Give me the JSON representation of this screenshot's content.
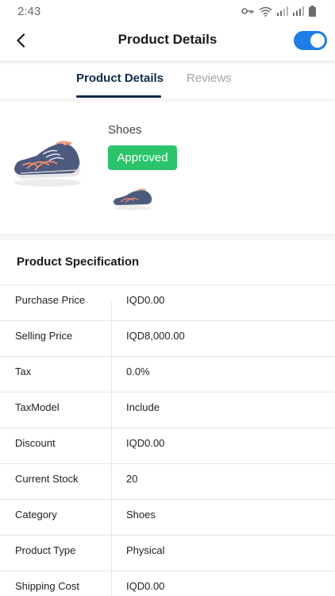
{
  "status_bar": {
    "time": "2:43"
  },
  "header": {
    "title": "Product Details",
    "toggle_on": true,
    "accent_color": "#1e7de6"
  },
  "tabs": [
    {
      "label": "Product Details",
      "active": true
    },
    {
      "label": "Reviews",
      "active": false
    }
  ],
  "product": {
    "name": "Shoes",
    "status": "Approved",
    "status_color": "#2bc46a",
    "image": "shoe-image",
    "thumbnails": [
      "shoe-thumbnail"
    ]
  },
  "specification": {
    "title": "Product Specification",
    "rows": [
      {
        "label": "Purchase Price",
        "value": "IQD0.00"
      },
      {
        "label": "Selling Price",
        "value": "IQD8,000.00"
      },
      {
        "label": "Tax",
        "value": "0.0%"
      },
      {
        "label": "TaxModel",
        "value": "Include"
      },
      {
        "label": "Discount",
        "value": "IQD0.00"
      },
      {
        "label": "Current Stock",
        "value": "20"
      },
      {
        "label": "Category",
        "value": "Shoes"
      },
      {
        "label": "Product Type",
        "value": "Physical"
      },
      {
        "label": "Shipping Cost",
        "value": "IQD0.00"
      }
    ]
  }
}
